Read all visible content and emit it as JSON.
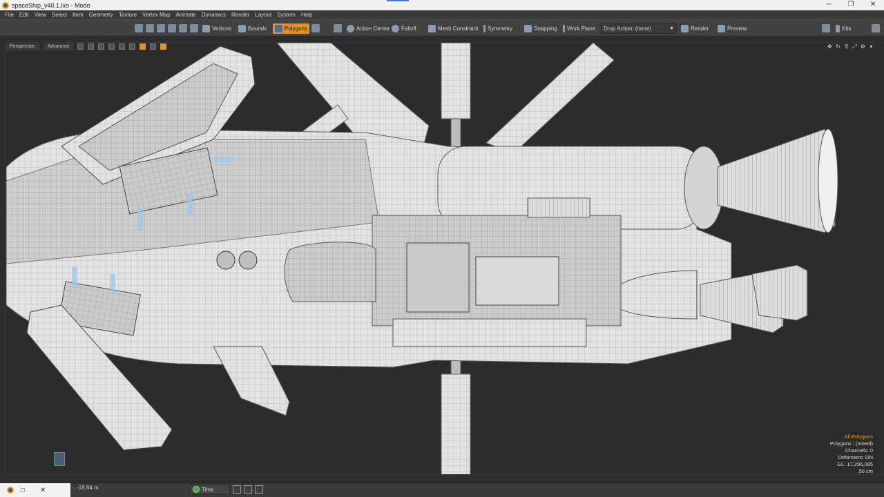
{
  "window": {
    "title": "spaceShip_v40.1.lxo - Modo",
    "controls": [
      "─",
      "❐",
      "✕"
    ]
  },
  "menu": [
    "File",
    "Edit",
    "View",
    "Select",
    "Item",
    "Geometry",
    "Texture",
    "Vertex Map",
    "Animate",
    "Dynamics",
    "Render",
    "Layout",
    "System",
    "Help"
  ],
  "toolbar": {
    "vertices": "Vertices",
    "bounds": "Bounds",
    "polygons": "Polygons",
    "action_center": "Action Center",
    "falloff": "Falloff",
    "mesh_constraint": "Mesh Constraint",
    "symmetry": "Symmetry",
    "snapping": "Snapping",
    "work_plane": "Work Plane",
    "drop_action": "Drop Action: (none)",
    "render": "Render",
    "preview": "Preview",
    "kits": "Kits",
    "active_color": "#e0912a"
  },
  "viewport": {
    "view_label": "Perspective",
    "shading_label": "Advanced"
  },
  "stats": {
    "selection": "All Polygons",
    "polygons": "Polygons : (mixed)",
    "channels": "Channels: 0",
    "deformers": "Deformers: ON",
    "gl": "GL: 17,296,085",
    "grid": "50 cm"
  },
  "status": {
    "coords": "·, -16.84 m",
    "time_label": "Time"
  }
}
